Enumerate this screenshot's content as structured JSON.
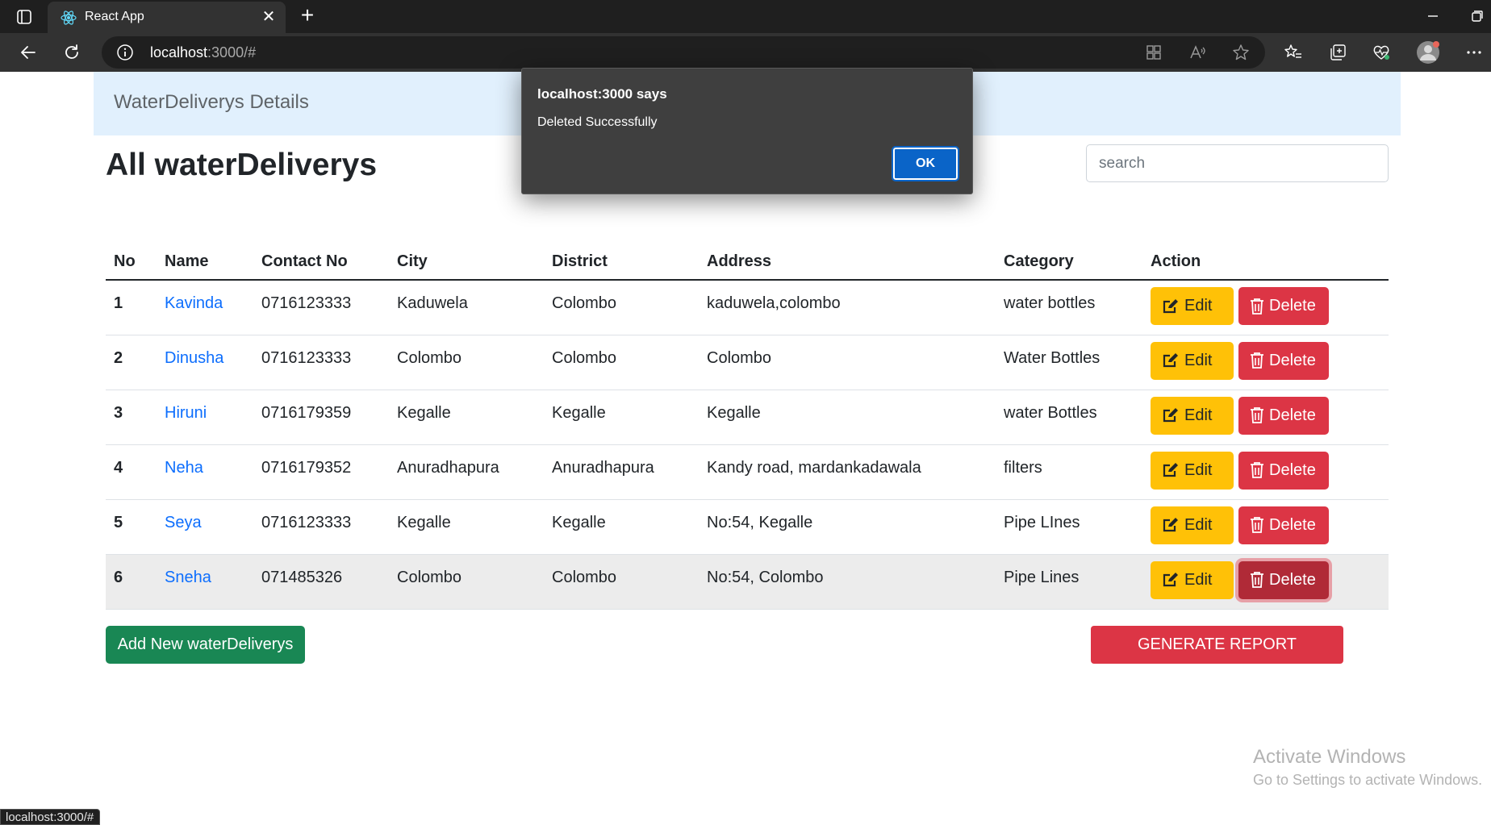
{
  "browser": {
    "tab_title": "React App",
    "address_host": "localhost",
    "address_rest": ":3000/#",
    "status_url": "localhost:3000/#"
  },
  "header": {
    "brand": "WaterDeliverys Details"
  },
  "main": {
    "title": "All waterDeliverys",
    "search_placeholder": "search",
    "columns": [
      "No",
      "Name",
      "Contact No",
      "City",
      "District",
      "Address",
      "Category",
      "Action"
    ],
    "rows": [
      {
        "no": "1",
        "name": "Kavinda",
        "contact": "0716123333",
        "city": "Kaduwela",
        "district": "Colombo",
        "address": "kaduwela,colombo",
        "category": "water bottles"
      },
      {
        "no": "2",
        "name": "Dinusha",
        "contact": "0716123333",
        "city": "Colombo",
        "district": "Colombo",
        "address": "Colombo",
        "category": "Water Bottles"
      },
      {
        "no": "3",
        "name": "Hiruni",
        "contact": "0716179359",
        "city": "Kegalle",
        "district": "Kegalle",
        "address": "Kegalle",
        "category": "water Bottles"
      },
      {
        "no": "4",
        "name": "Neha",
        "contact": "0716179352",
        "city": "Anuradhapura",
        "district": "Anuradhapura",
        "address": "Kandy road, mardankadawala",
        "category": "filters"
      },
      {
        "no": "5",
        "name": "Seya",
        "contact": "0716123333",
        "city": "Kegalle",
        "district": "Kegalle",
        "address": "No:54, Kegalle",
        "category": "Pipe LInes"
      },
      {
        "no": "6",
        "name": "Sneha",
        "contact": "071485326",
        "city": "Colombo",
        "district": "Colombo",
        "address": "No:54, Colombo",
        "category": "Pipe Lines"
      }
    ],
    "edit_label": "Edit",
    "delete_label": "Delete",
    "add_label": "Add New waterDeliverys",
    "report_label": "GENERATE REPORT"
  },
  "dialog": {
    "title": "localhost:3000 says",
    "message": "Deleted Successfully",
    "ok_label": "OK"
  },
  "os": {
    "activate_title": "Activate Windows",
    "activate_sub": "Go to Settings to activate Windows."
  },
  "colors": {
    "primary_link": "#0d6efd",
    "edit": "#ffc107",
    "delete": "#dc3545",
    "add": "#198754",
    "header_bg": "#e1f0fd"
  }
}
